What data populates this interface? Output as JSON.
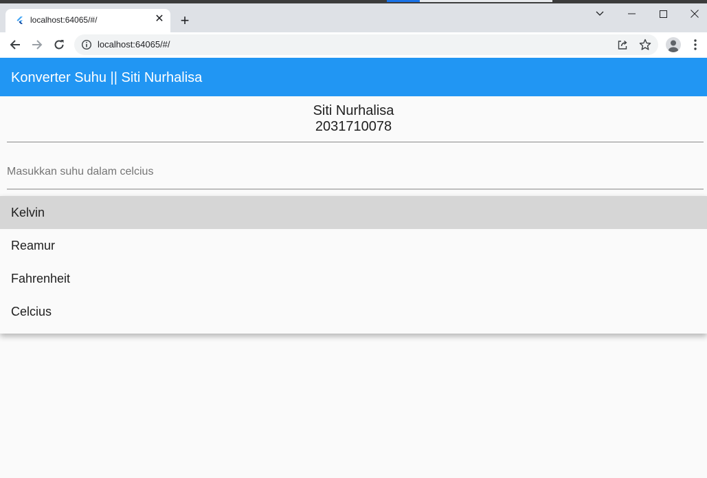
{
  "browser": {
    "tab_title": "localhost:64065/#/",
    "url": "localhost:64065/#/",
    "new_tab_symbol": "+",
    "close_symbol": "✕",
    "icons": [
      "flutter-favicon",
      "close-icon",
      "new-tab-icon",
      "tab-search-icon",
      "minimize-icon",
      "maximize-icon",
      "window-close-icon",
      "back-icon",
      "forward-icon",
      "reload-icon",
      "site-info-icon",
      "share-icon",
      "bookmark-star-icon",
      "profile-icon",
      "menu-icon"
    ]
  },
  "app": {
    "title": "Konverter Suhu || Siti Nurhalisa",
    "accent_color": "#2196f3",
    "name": "Siti Nurhalisa",
    "student_id": "2031710078",
    "input": {
      "placeholder": "Masukkan suhu dalam celcius",
      "value": ""
    },
    "dropdown": {
      "selected": "Kelvin",
      "options": [
        "Kelvin",
        "Reamur",
        "Fahrenheit",
        "Celcius"
      ]
    }
  }
}
